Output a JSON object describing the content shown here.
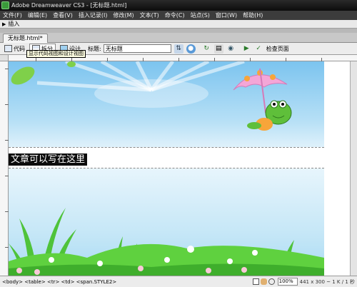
{
  "window": {
    "title": "Adobe Dreamweaver CS3 - [无标题.html]"
  },
  "menu": [
    "文件(F)",
    "编辑(E)",
    "查看(V)",
    "插入记录(I)",
    "修改(M)",
    "文本(T)",
    "命令(C)",
    "站点(S)",
    "窗口(W)",
    "帮助(H)"
  ],
  "insert_bar": {
    "label": "插入"
  },
  "document": {
    "tab_label": "无标题.html*"
  },
  "toolbar": {
    "code_label": "代码",
    "split_label": "拆分",
    "design_label": "设计",
    "title_label": "标题:",
    "title_value": "无标题",
    "check_page_label": "检查页面"
  },
  "tooltip": {
    "text": "显示代码视图和设计视图"
  },
  "canvas": {
    "text": "文章可以写在这里"
  },
  "status": {
    "path": "<body> <table> <tr> <td> <span.STYLE2>",
    "zoom": "100%",
    "size": "441 x 300 ~ 1 K / 1 秒"
  },
  "colors": {
    "sky": "#7cc4ef",
    "grass": "#4fc33a",
    "umbrella": "#f4a6d7",
    "text_bg": "#0c0c0c"
  },
  "icons": [
    "app-icon",
    "code-view-icon",
    "split-view-icon",
    "design-view-icon",
    "file-mgmt-icon",
    "preview-globe-icon",
    "refresh-icon",
    "view-options-icon",
    "visual-aids-icon",
    "validate-icon",
    "browser-check-icon",
    "select-tool-icon",
    "hand-tool-icon",
    "zoom-tool-icon"
  ]
}
